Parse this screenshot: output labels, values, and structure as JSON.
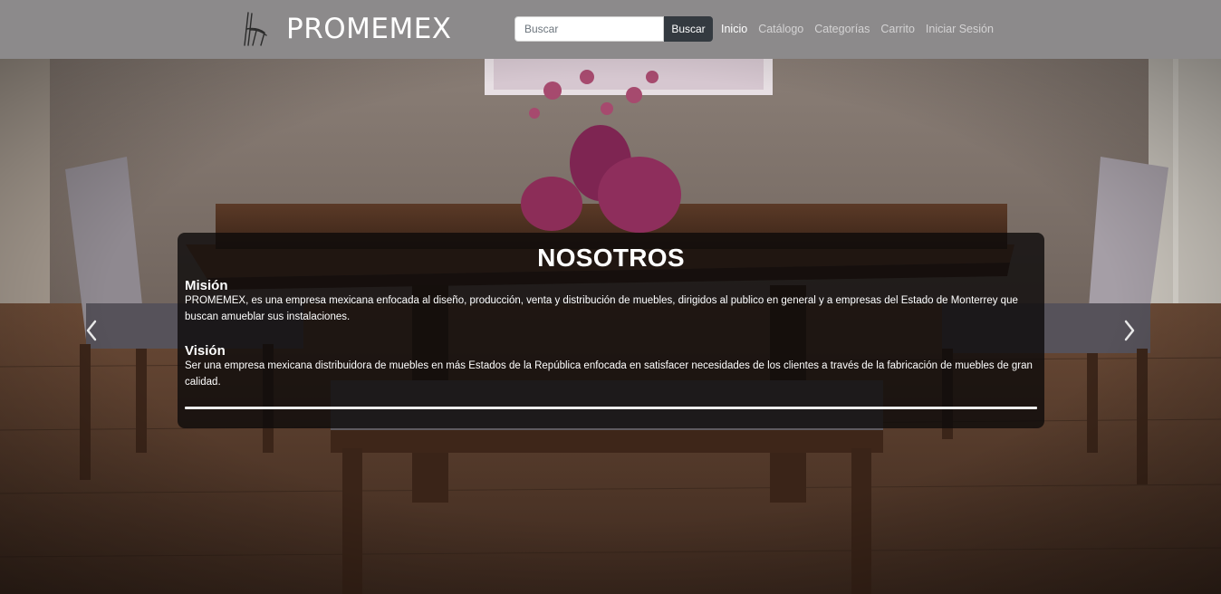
{
  "brand": {
    "name": "PROMEMEX"
  },
  "search": {
    "placeholder": "Buscar",
    "button_label": "Buscar"
  },
  "nav": {
    "links": [
      {
        "label": "Inicio",
        "active": true
      },
      {
        "label": "Catálogo",
        "active": false
      },
      {
        "label": "Categorías",
        "active": false
      },
      {
        "label": "Carrito",
        "active": false
      },
      {
        "label": "Iniciar Sesión",
        "active": false
      }
    ]
  },
  "hero": {
    "title": "NOSOTROS",
    "mision": {
      "heading": "Misión",
      "text": "PROMEMEX, es una empresa mexicana enfocada al diseño, producción, venta y distribución de muebles, dirigidos al publico en general y a empresas del Estado de Monterrey que buscan amueblar sus instalaciones."
    },
    "vision": {
      "heading": "Visión",
      "text": "Ser una empresa mexicana distribuidora de muebles en más Estados de la República enfocada en satisfacer necesidades de los clientes a través de la fabricación de muebles de gran calidad."
    }
  },
  "icons": {
    "brand_logo": "chair-logo-icon",
    "prev": "chevron-left-icon",
    "next": "chevron-right-icon"
  },
  "colors": {
    "navbar_bg": "#8c8a8b",
    "search_button_bg": "#343a40",
    "caption_bg": "rgba(12,10,10,0.80)"
  }
}
